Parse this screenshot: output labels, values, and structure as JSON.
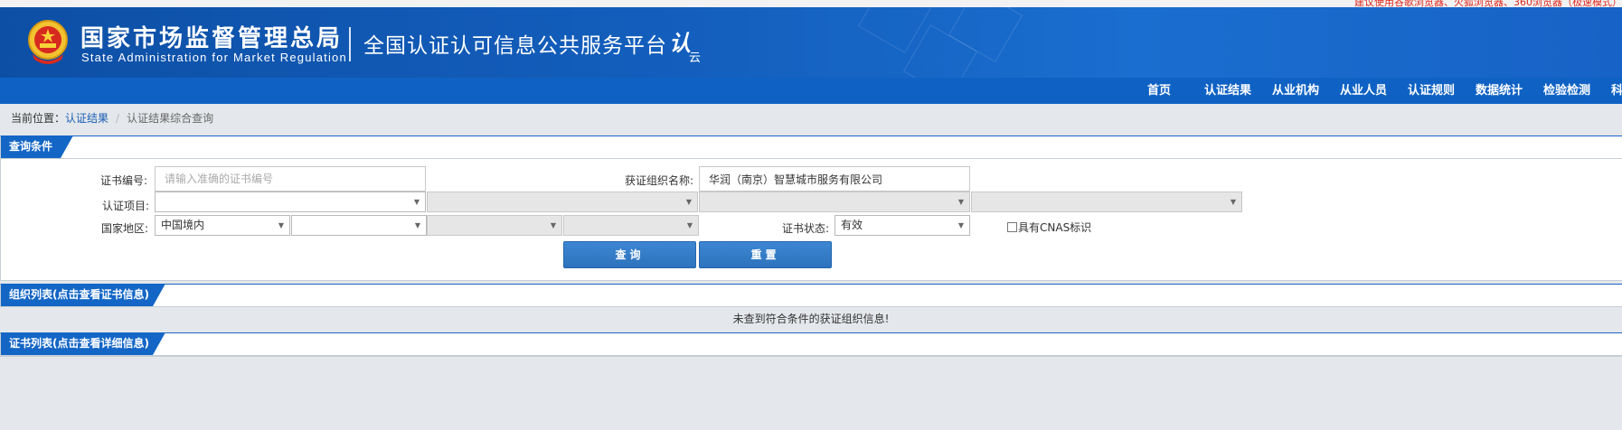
{
  "top_notice": "建议使用谷歌浏览器、火狐浏览器、360浏览器（极速模式）",
  "header": {
    "title_cn": "国家市场监督管理总局",
    "title_en": "State Administration  for  Market Regulation",
    "platform_name": "全国认证认可信息公共服务平台",
    "logo_big": "认",
    "logo_small": "云"
  },
  "nav": [
    {
      "label": "首页"
    },
    {
      "label": "认证结果"
    },
    {
      "label": "从业机构"
    },
    {
      "label": "从业人员"
    },
    {
      "label": "认证规则"
    },
    {
      "label": "数据统计"
    },
    {
      "label": "检验检测"
    },
    {
      "label": "科"
    }
  ],
  "breadcrumb": {
    "prefix": "当前位置：",
    "link": "认证结果",
    "separator": "/",
    "current": "认证结果综合查询"
  },
  "query": {
    "title": "查询条件",
    "cert_no_label": "证书编号:",
    "cert_no_placeholder": "请输入准确的证书编号",
    "org_name_label": "获证组织名称:",
    "org_name_value": "华润（南京）智慧城市服务有限公司",
    "project_label": "认证项目:",
    "region_label": "国家地区:",
    "region_value": "中国境内",
    "status_label": "证书状态:",
    "status_value": "有效",
    "cnas_label": "具有CNAS标识",
    "search_button": "查询",
    "reset_button": "重置"
  },
  "org_list": {
    "title": "组织列表(点击查看证书信息)",
    "empty_message": "未查到符合条件的获证组织信息!"
  },
  "cert_list": {
    "title": "证书列表(点击查看详细信息)"
  },
  "colors": {
    "header_blue": "#1460bf",
    "nav_blue": "#0f62c4",
    "tag_blue": "#1466c6",
    "button_blue": "#2d73bd",
    "page_bg": "#e4e7eb"
  }
}
